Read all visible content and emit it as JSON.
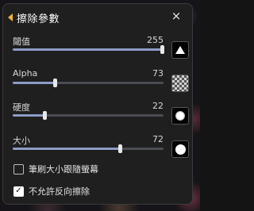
{
  "panel": {
    "title": "擦除參數",
    "close_icon": "×"
  },
  "sliders": [
    {
      "label": "閾值",
      "value": "255",
      "fraction": 1.0,
      "swatch": "triangle-shape-icon"
    },
    {
      "label": "Alpha",
      "value": "73",
      "fraction": 0.29,
      "swatch": "transparency-checker-icon"
    },
    {
      "label": "硬度",
      "value": "22",
      "fraction": 0.22,
      "swatch": "soft-brush-icon"
    },
    {
      "label": "大小",
      "value": "72",
      "fraction": 0.72,
      "swatch": "hard-brush-icon"
    }
  ],
  "options": [
    {
      "label": "筆刷大小跟隨螢幕",
      "checked": false
    },
    {
      "label": "不允許反向擦除",
      "checked": true
    }
  ],
  "colors": {
    "accent": "#f0b43a",
    "slider_fill": "#8d9bc7",
    "track": "#4b4d55",
    "panel_bg": "#1f1f1f"
  }
}
